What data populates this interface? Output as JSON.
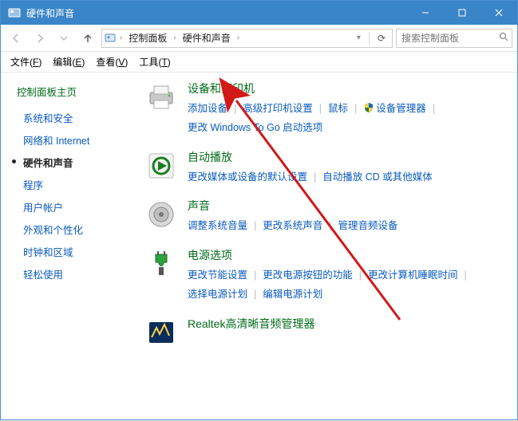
{
  "window": {
    "title": "硬件和声音"
  },
  "titlebar_buttons": {
    "min": "minimize",
    "max": "maximize",
    "close": "close"
  },
  "breadcrumbs": {
    "root_sep": "›",
    "items": [
      "控制面板",
      "硬件和声音"
    ],
    "dropdown_glyph": "▾",
    "refresh_glyph": "⟳"
  },
  "search": {
    "placeholder": "搜索控制面板"
  },
  "menu": {
    "file": {
      "label": "文件",
      "accel": "F"
    },
    "edit": {
      "label": "编辑",
      "accel": "E"
    },
    "view": {
      "label": "查看",
      "accel": "V"
    },
    "tools": {
      "label": "工具",
      "accel": "T"
    }
  },
  "sidebar": {
    "title": "控制面板主页",
    "items": [
      {
        "label": "系统和安全",
        "current": false
      },
      {
        "label": "网络和 Internet",
        "current": false
      },
      {
        "label": "硬件和声音",
        "current": true
      },
      {
        "label": "程序",
        "current": false
      },
      {
        "label": "用户帐户",
        "current": false
      },
      {
        "label": "外观和个性化",
        "current": false
      },
      {
        "label": "时钟和区域",
        "current": false
      },
      {
        "label": "轻松使用",
        "current": false
      }
    ]
  },
  "categories": [
    {
      "icon": "printer-icon",
      "title": "设备和打印机",
      "links": [
        {
          "label": "添加设备"
        },
        {
          "label": "高级打印机设置"
        },
        {
          "label": "鼠标"
        },
        {
          "label": "设备管理器",
          "shield": true
        },
        {
          "label": "更改 Windows To Go 启动选项"
        }
      ]
    },
    {
      "icon": "autoplay-icon",
      "title": "自动播放",
      "links": [
        {
          "label": "更改媒体或设备的默认设置"
        },
        {
          "label": "自动播放 CD 或其他媒体"
        }
      ]
    },
    {
      "icon": "sound-icon",
      "title": "声音",
      "links": [
        {
          "label": "调整系统音量"
        },
        {
          "label": "更改系统声音"
        },
        {
          "label": "管理音频设备"
        }
      ]
    },
    {
      "icon": "power-icon",
      "title": "电源选项",
      "links": [
        {
          "label": "更改节能设置"
        },
        {
          "label": "更改电源按钮的功能"
        },
        {
          "label": "更改计算机睡眠时间"
        },
        {
          "label": "选择电源计划"
        },
        {
          "label": "编辑电源计划"
        }
      ]
    },
    {
      "icon": "realtek-icon",
      "title": "Realtek高清晰音频管理器",
      "links": []
    }
  ],
  "colors": {
    "titlebar": "#3a85c8",
    "link": "#0a5bbf",
    "heading": "#006b19",
    "annotation_arrow": "#d11919"
  }
}
